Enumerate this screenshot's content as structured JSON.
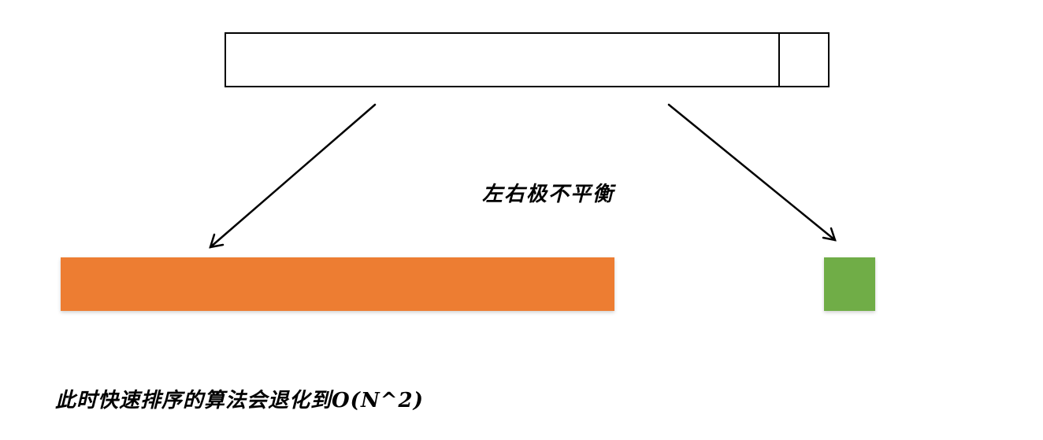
{
  "diagram": {
    "unbalanced_label": "左右极不平衡",
    "degrade_label": "此时快速排序的算法会退化到O(N^2)",
    "colors": {
      "outline": "#000000",
      "left_partition": "#ED7D31",
      "right_partition": "#70AD47",
      "background": "#FFFFFF"
    }
  }
}
